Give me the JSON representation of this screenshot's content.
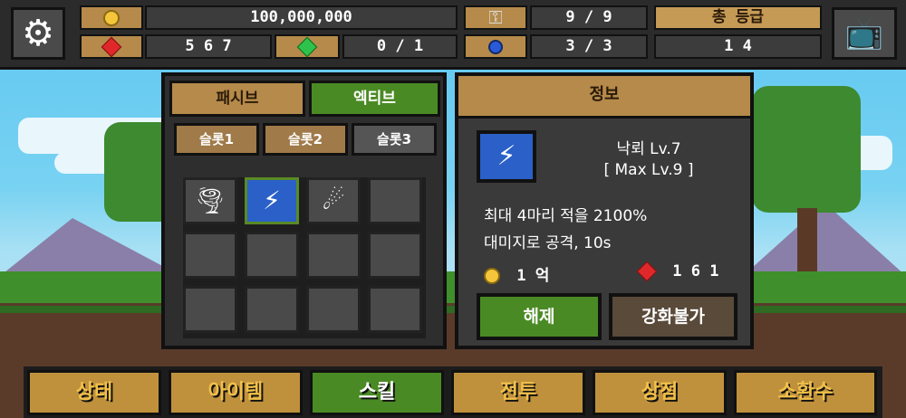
{
  "top": {
    "gold": "100,000,000",
    "keys": "9 / 9",
    "floor_label": "총 등급",
    "ruby": "5 6 7",
    "emerald": "0 / 1",
    "potion": "3 / 3",
    "floor_value": "1 4"
  },
  "skills": {
    "tabs": {
      "passive": "패시브",
      "active": "엑티브"
    },
    "slots": [
      "슬롯1",
      "슬롯2",
      "슬롯3"
    ],
    "grid_icons": [
      "tornado-icon",
      "lightning-icon",
      "fireball-icon"
    ]
  },
  "info": {
    "title": "정보",
    "name": "낙뢰 Lv.7",
    "max": "[ Max Lv.9 ]",
    "desc1": "최대 4마리 적을 2100%",
    "desc2": "대미지로 공격, 10s",
    "gold_cost": "1 억",
    "ruby_cost": "1 6 1",
    "release_label": "해제",
    "upgrade_label": "강화불가"
  },
  "nav": {
    "items": [
      "상태",
      "아이템",
      "스킬",
      "전투",
      "상점",
      "소환수"
    ],
    "active": "스킬"
  },
  "colors": {
    "accent_green": "#4a8a24",
    "accent_brown": "#b58a4a",
    "selection_blue": "#2a60c8"
  }
}
